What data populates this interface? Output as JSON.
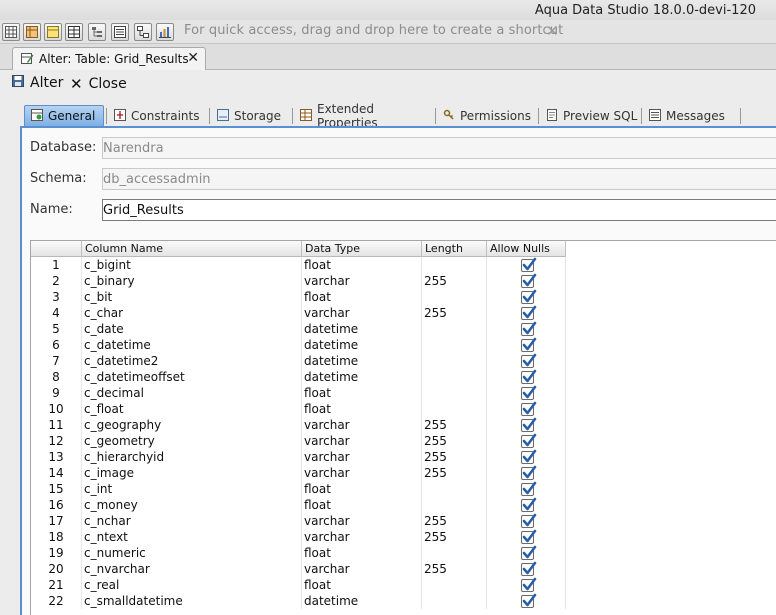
{
  "app": {
    "title": "Aqua Data Studio 18.0.0-devi-120"
  },
  "toolbar": {
    "buttons": [
      "grid-icon",
      "table-orange-icon",
      "table-yellow-icon",
      "grid-icon",
      "tree-icon",
      "list-icon",
      "diagram-icon",
      "bar-chart-icon"
    ],
    "shortcut_hint": "For quick access, drag and drop here to create a shortcut",
    "hint_close": "✕"
  },
  "doc_tab": {
    "label": "Alter: Table: Grid_Results",
    "close": "✕"
  },
  "actions": {
    "alter_label": "Alter",
    "close_label": "Close"
  },
  "subtabs": [
    {
      "label": "General",
      "active": true
    },
    {
      "label": "Constraints"
    },
    {
      "label": "Storage"
    },
    {
      "label": "Extended Properties"
    },
    {
      "label": "Permissions"
    },
    {
      "label": "Preview SQL"
    },
    {
      "label": "Messages"
    }
  ],
  "form": {
    "database_label": "Database:",
    "database_value": "Narendra",
    "schema_label": "Schema:",
    "schema_value": "db_accessadmin",
    "name_label": "Name:",
    "name_value": "Grid_Results"
  },
  "grid": {
    "headers": [
      "",
      "Column Name",
      "Data Type",
      "Length",
      "Allow Nulls"
    ],
    "rows": [
      {
        "n": "1",
        "name": "c_bigint",
        "type": "float",
        "len": "",
        "nulls": true
      },
      {
        "n": "2",
        "name": "c_binary",
        "type": "varchar",
        "len": "255",
        "nulls": true
      },
      {
        "n": "3",
        "name": "c_bit",
        "type": "float",
        "len": "",
        "nulls": true
      },
      {
        "n": "4",
        "name": "c_char",
        "type": "varchar",
        "len": "255",
        "nulls": true
      },
      {
        "n": "5",
        "name": "c_date",
        "type": "datetime",
        "len": "",
        "nulls": true
      },
      {
        "n": "6",
        "name": "c_datetime",
        "type": "datetime",
        "len": "",
        "nulls": true
      },
      {
        "n": "7",
        "name": "c_datetime2",
        "type": "datetime",
        "len": "",
        "nulls": true
      },
      {
        "n": "8",
        "name": "c_datetimeoffset",
        "type": "datetime",
        "len": "",
        "nulls": true
      },
      {
        "n": "9",
        "name": "c_decimal",
        "type": "float",
        "len": "",
        "nulls": true
      },
      {
        "n": "10",
        "name": "c_float",
        "type": "float",
        "len": "",
        "nulls": true
      },
      {
        "n": "11",
        "name": "c_geography",
        "type": "varchar",
        "len": "255",
        "nulls": true
      },
      {
        "n": "12",
        "name": "c_geometry",
        "type": "varchar",
        "len": "255",
        "nulls": true
      },
      {
        "n": "13",
        "name": "c_hierarchyid",
        "type": "varchar",
        "len": "255",
        "nulls": true
      },
      {
        "n": "14",
        "name": "c_image",
        "type": "varchar",
        "len": "255",
        "nulls": true
      },
      {
        "n": "15",
        "name": "c_int",
        "type": "float",
        "len": "",
        "nulls": true
      },
      {
        "n": "16",
        "name": "c_money",
        "type": "float",
        "len": "",
        "nulls": true
      },
      {
        "n": "17",
        "name": "c_nchar",
        "type": "varchar",
        "len": "255",
        "nulls": true
      },
      {
        "n": "18",
        "name": "c_ntext",
        "type": "varchar",
        "len": "255",
        "nulls": true
      },
      {
        "n": "19",
        "name": "c_numeric",
        "type": "float",
        "len": "",
        "nulls": true
      },
      {
        "n": "20",
        "name": "c_nvarchar",
        "type": "varchar",
        "len": "255",
        "nulls": true
      },
      {
        "n": "21",
        "name": "c_real",
        "type": "float",
        "len": "",
        "nulls": true
      },
      {
        "n": "22",
        "name": "c_smalldatetime",
        "type": "datetime",
        "len": "",
        "nulls": true
      }
    ]
  },
  "colors": {
    "accent": "#5a8fd0",
    "check": "#2c5fa8"
  }
}
